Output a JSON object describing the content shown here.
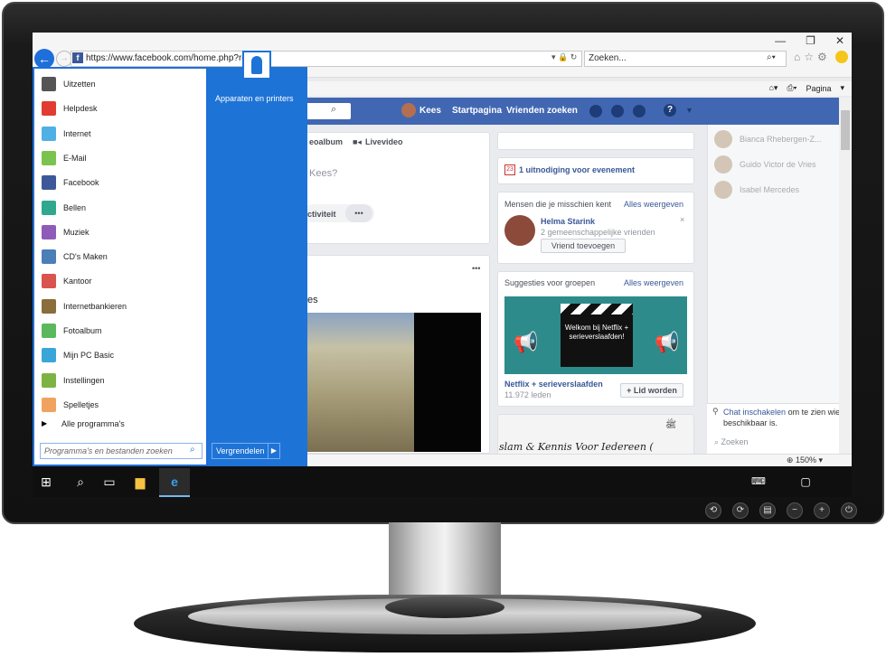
{
  "browser": {
    "url": "https://www.facebook.com/home.php?ref=wiz",
    "search_placeholder": "Zoeken...",
    "command_page": "Pagina",
    "zoom": "150%"
  },
  "facebook": {
    "user_name": "Kees",
    "nav": [
      "Startpagina",
      "Vrienden zoeken"
    ],
    "composer": {
      "tab_photo": "eoalbum",
      "tab_live": "Livevideo",
      "prompt": "Kees?",
      "activity": "ctiviteit",
      "more": "•••"
    },
    "feed": {
      "more": "•••",
      "caption": "es"
    },
    "event": {
      "badge": "23",
      "text": "1 uitnodiging voor evenement"
    },
    "people": {
      "heading": "Mensen die je misschien kent",
      "see_all": "Alles weergeven",
      "name": "Helma Starink",
      "mutual": "2 gemeenschappelijke vrienden",
      "add_button": "Vriend toevoegen",
      "close": "×"
    },
    "groups": {
      "heading": "Suggesties voor groepen",
      "see_all": "Alles weergeven",
      "image_text": "Welkom bij Netflix + serieverslaafden!",
      "group_name": "Netflix + serieverslaafden",
      "members": "11.972 leden",
      "join_button": "+ Lid worden",
      "next_caption": "slam & Kennis Voor Iedereen (",
      "next_top": "ﷺ"
    },
    "chat": {
      "contacts": [
        "Bianca Rhebergen-Z...",
        "Guido Victor de Vries",
        "Isabel Mercedes"
      ],
      "enable_link": "Chat inschakelen",
      "enable_rest": "om te zien wie beschikbaar is.",
      "search": "Zoeken"
    }
  },
  "start_menu": {
    "items": [
      {
        "label": "Uitzetten",
        "icon": "power-icon",
        "color": "#555555"
      },
      {
        "label": "Helpdesk",
        "icon": "helpdesk-icon",
        "color": "#e03c31"
      },
      {
        "label": "Internet",
        "icon": "internet-icon",
        "color": "#4fb0e6"
      },
      {
        "label": "E-Mail",
        "icon": "email-icon",
        "color": "#7cc24f"
      },
      {
        "label": "Facebook",
        "icon": "facebook-icon",
        "color": "#3b5998"
      },
      {
        "label": "Bellen",
        "icon": "phone-icon",
        "color": "#2fa88e"
      },
      {
        "label": "Muziek",
        "icon": "music-icon",
        "color": "#8e5cb8"
      },
      {
        "label": "CD's Maken",
        "icon": "cd-icon",
        "color": "#4b7fb8"
      },
      {
        "label": "Kantoor",
        "icon": "office-icon",
        "color": "#d9534f"
      },
      {
        "label": "Internetbankieren",
        "icon": "bank-icon",
        "color": "#8a6d3b"
      },
      {
        "label": "Fotoalbum",
        "icon": "photo-icon",
        "color": "#5cb85c"
      },
      {
        "label": "Mijn PC Basic",
        "icon": "pc-icon",
        "color": "#3aa6d8"
      },
      {
        "label": "Instellingen",
        "icon": "settings-icon",
        "color": "#7cb342"
      },
      {
        "label": "Spelletjes",
        "icon": "games-icon",
        "color": "#f0a35e"
      }
    ],
    "all_programs": "Alle programma's",
    "search_placeholder": "Programma's en bestanden zoeken",
    "devices": "Apparaten en printers",
    "lock": "Vergrendelen"
  }
}
